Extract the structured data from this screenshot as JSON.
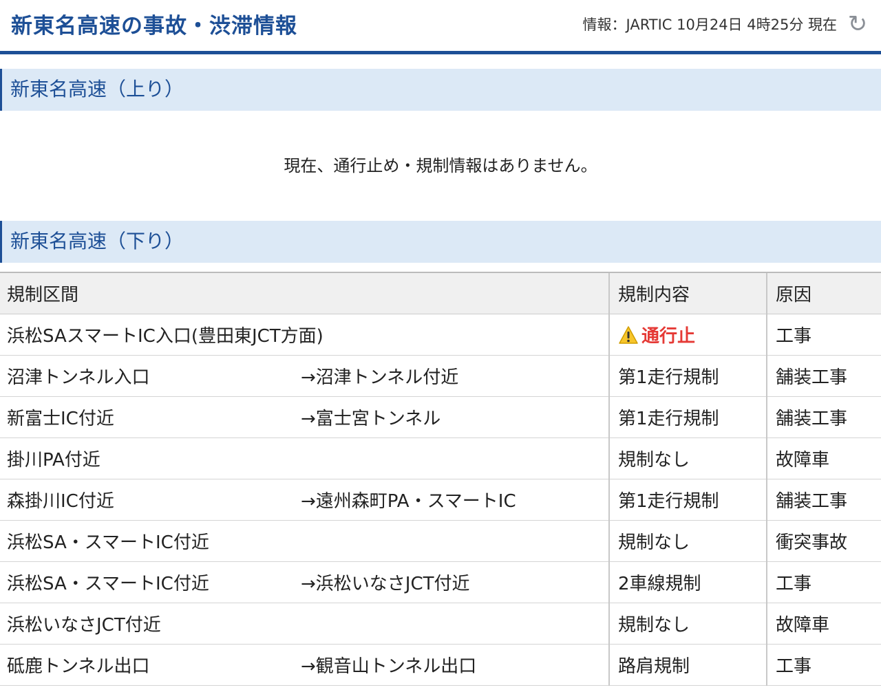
{
  "header": {
    "title": "新東名高速の事故・渋滞情報",
    "info": "情報：JARTIC 10月24日 4時25分 現在"
  },
  "up": {
    "heading": "新東名高速（上り）",
    "message": "現在、通行止め・規制情報はありません。"
  },
  "down": {
    "heading": "新東名高速（下り）",
    "columns": [
      "規制区間",
      "規制内容",
      "原因"
    ],
    "rows": [
      {
        "from": "浜松SAスマートIC入口(豊田東JCT方面)",
        "to": "",
        "regulation": "通行止",
        "cause": "工事"
      },
      {
        "from": "沼津トンネル入口",
        "to": "→沼津トンネル付近",
        "regulation": "第1走行規制",
        "cause": "舗装工事"
      },
      {
        "from": "新富士IC付近",
        "to": "→富士宮トンネル",
        "regulation": "第1走行規制",
        "cause": "舗装工事"
      },
      {
        "from": "掛川PA付近",
        "to": "",
        "regulation": "規制なし",
        "cause": "故障車"
      },
      {
        "from": "森掛川IC付近",
        "to": "→遠州森町PA・スマートIC",
        "regulation": "第1走行規制",
        "cause": "舗装工事"
      },
      {
        "from": "浜松SA・スマートIC付近",
        "to": "",
        "regulation": "規制なし",
        "cause": "衝突事故"
      },
      {
        "from": "浜松SA・スマートIC付近",
        "to": "→浜松いなさJCT付近",
        "regulation": "2車線規制",
        "cause": "工事"
      },
      {
        "from": "浜松いなさJCT付近",
        "to": "",
        "regulation": "規制なし",
        "cause": "故障車"
      },
      {
        "from": "砥鹿トンネル出口",
        "to": "→観音山トンネル出口",
        "regulation": "路肩規制",
        "cause": "工事"
      }
    ]
  },
  "icons": {
    "refresh": "refresh-icon",
    "warning": "warning-icon"
  },
  "colors": {
    "brand": "#1d4f96",
    "section_bg": "#dce9f6",
    "stop": "#e53935"
  }
}
